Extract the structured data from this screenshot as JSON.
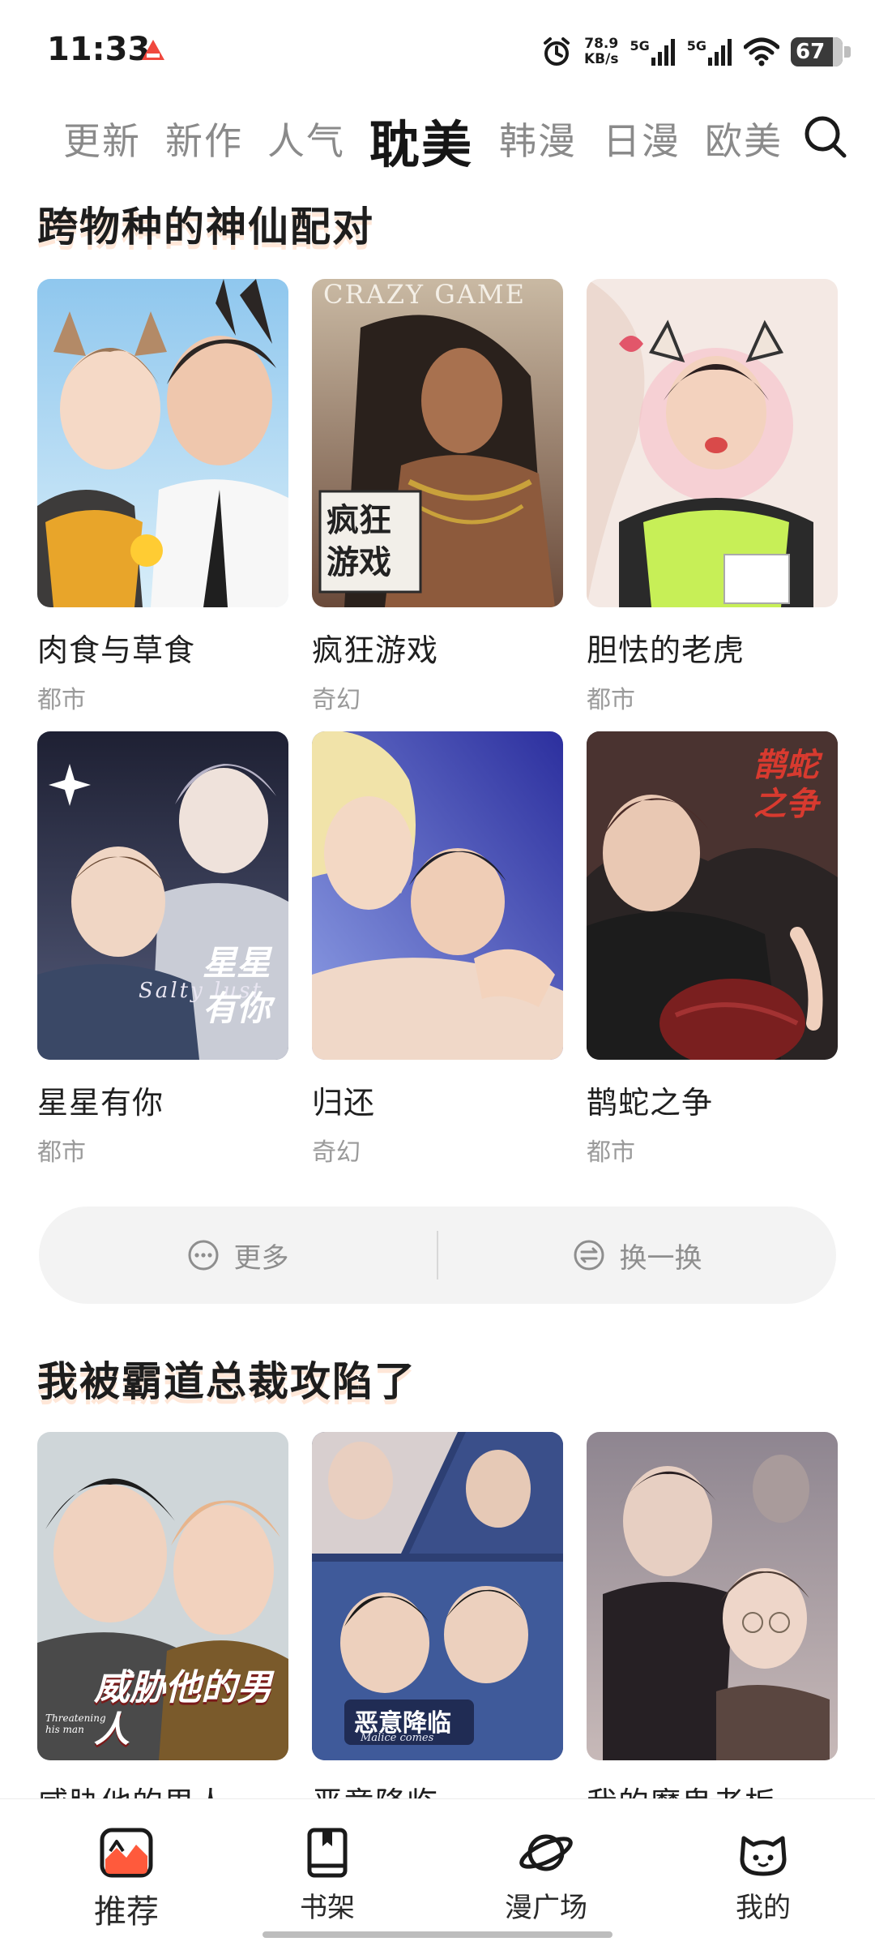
{
  "status_bar": {
    "time": "11:33",
    "net_speed_value": "78.9",
    "net_speed_unit": "KB/s",
    "network_1": "5G",
    "network_2": "5G",
    "battery": "67"
  },
  "top_tabs": {
    "items": [
      {
        "label": "更新"
      },
      {
        "label": "新作"
      },
      {
        "label": "人气"
      },
      {
        "label": "耽美",
        "active": true
      },
      {
        "label": "韩漫"
      },
      {
        "label": "日漫"
      },
      {
        "label": "欧美"
      }
    ],
    "search_icon": "search-icon"
  },
  "sections": [
    {
      "title": "跨物种的神仙配对",
      "cards": [
        {
          "title": "肉食与草食",
          "genre": "都市"
        },
        {
          "title": "疯狂游戏",
          "genre": "奇幻",
          "cover_text": "CRAZY GAME",
          "cover_badge": "疯狂游戏"
        },
        {
          "title": "胆怯的老虎",
          "genre": "都市"
        },
        {
          "title": "星星有你",
          "genre": "都市",
          "cover_text": "Salty lust",
          "cover_badge": "星星有你"
        },
        {
          "title": "归还",
          "genre": "奇幻"
        },
        {
          "title": "鹊蛇之争",
          "genre": "都市",
          "cover_badge": "鹊蛇之争"
        }
      ]
    },
    {
      "title": "我被霸道总裁攻陷了",
      "cards": [
        {
          "title": "威胁他的男人",
          "cover_badge": "威胁他的男人",
          "cover_text": "Threatening his man"
        },
        {
          "title": "恶意降临",
          "cover_badge": "恶意降临",
          "cover_text": "Malice comes"
        },
        {
          "title": "我的魔鬼老板"
        }
      ]
    }
  ],
  "actions": {
    "more_label": "更多",
    "shuffle_label": "换一换"
  },
  "bottom_nav": {
    "items": [
      {
        "label": "推荐",
        "icon": "recommend-icon",
        "active": true
      },
      {
        "label": "书架",
        "icon": "bookshelf-icon"
      },
      {
        "label": "漫广场",
        "icon": "planet-icon"
      },
      {
        "label": "我的",
        "icon": "cat-face-icon"
      }
    ]
  },
  "colors": {
    "accent": "#ff5a3c",
    "text_primary": "#1d1d1d",
    "text_secondary": "#9a9a9a",
    "pill_bg": "#f3f3f3"
  }
}
